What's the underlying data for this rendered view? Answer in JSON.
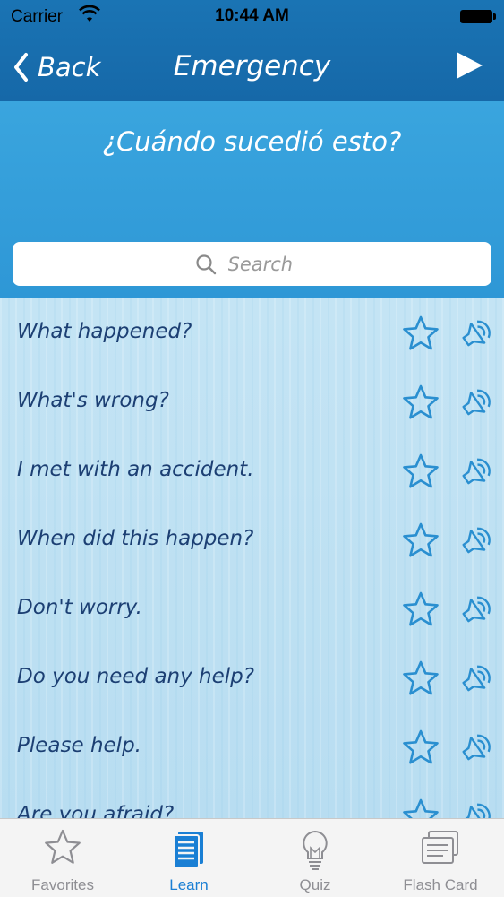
{
  "status_bar": {
    "carrier": "Carrier",
    "time": "10:44 AM"
  },
  "nav": {
    "back_label": "Back",
    "title": "Emergency"
  },
  "banner": {
    "phrase": "¿Cuándo sucedió esto?"
  },
  "search": {
    "placeholder": "Search"
  },
  "phrases": [
    "What happened?",
    "What's wrong?",
    "I met with an accident.",
    "When did this happen?",
    "Don't worry.",
    "Do you need any help?",
    "Please help.",
    "Are you afraid?"
  ],
  "tabs": [
    {
      "label": "Favorites",
      "icon": "star-icon",
      "active": false
    },
    {
      "label": "Learn",
      "icon": "document-list-icon",
      "active": true
    },
    {
      "label": "Quiz",
      "icon": "lightbulb-icon",
      "active": false
    },
    {
      "label": "Flash Card",
      "icon": "flash-card-icon",
      "active": false
    }
  ],
  "colors": {
    "nav_bg": "#1a74b4",
    "banner_bg": "#3aa5de",
    "phrase_text": "#1c3f73",
    "icon_blue": "#2a8fd0",
    "tab_active": "#1a7fd4",
    "tab_inactive": "#8e8e93"
  }
}
